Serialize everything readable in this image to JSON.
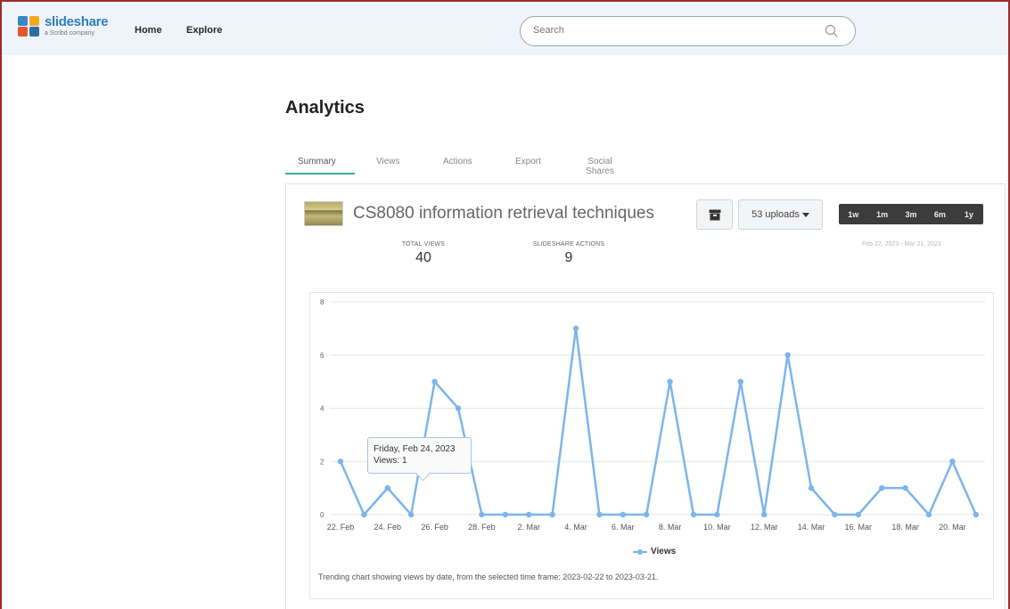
{
  "header": {
    "logo_name": "slideshare",
    "logo_sub": "a Scribd company",
    "nav": [
      "Home",
      "Explore"
    ],
    "search_placeholder": "Search"
  },
  "page_title": "Analytics",
  "tabs": [
    {
      "label": "Summary",
      "active": true
    },
    {
      "label": "Views",
      "active": false
    },
    {
      "label": "Actions",
      "active": false
    },
    {
      "label": "Export",
      "active": false
    },
    {
      "label": "Social Shares",
      "active": false
    }
  ],
  "document": {
    "title": "CS8080 information retrieval techniques",
    "uploads_label": "53 uploads",
    "ranges": [
      "1w",
      "1m",
      "3m",
      "6m",
      "1y"
    ],
    "date_range": "Feb 22, 2023 - Mar 21, 2023"
  },
  "stats": {
    "total_views_label": "TOTAL VIEWS",
    "total_views": "40",
    "actions_label": "SLIDESHARE ACTIONS",
    "actions": "9"
  },
  "tooltip": {
    "date": "Friday, Feb 24, 2023",
    "text": "Views: 1"
  },
  "caption": "Trending chart showing views by date, from the selected time frame: 2023-02-22 to 2023-03-21.",
  "colors": {
    "line": "#7cb5ec",
    "accent": "#3fa6a8",
    "brand": "#2e7fb5"
  },
  "chart_data": {
    "type": "line",
    "ylim": [
      0,
      8
    ],
    "yticks": [
      "0",
      "2",
      "4",
      "6",
      "8"
    ],
    "x_tick_labels": [
      "22. Feb",
      "24. Feb",
      "26. Feb",
      "28. Feb",
      "2. Mar",
      "4. Mar",
      "6. Mar",
      "8. Mar",
      "10. Mar",
      "12. Mar",
      "14. Mar",
      "16. Mar",
      "18. Mar",
      "20. Mar"
    ],
    "dates": [
      "2023-02-22",
      "2023-02-23",
      "2023-02-24",
      "2023-02-25",
      "2023-02-26",
      "2023-02-27",
      "2023-02-28",
      "2023-03-01",
      "2023-03-02",
      "2023-03-03",
      "2023-03-04",
      "2023-03-05",
      "2023-03-06",
      "2023-03-07",
      "2023-03-08",
      "2023-03-09",
      "2023-03-10",
      "2023-03-11",
      "2023-03-12",
      "2023-03-13",
      "2023-03-14",
      "2023-03-15",
      "2023-03-16",
      "2023-03-17",
      "2023-03-18",
      "2023-03-19",
      "2023-03-20",
      "2023-03-21"
    ],
    "series": [
      {
        "name": "Views",
        "values": [
          2,
          0,
          1,
          0,
          5,
          4,
          0,
          0,
          0,
          0,
          7,
          0,
          0,
          0,
          5,
          0,
          0,
          5,
          0,
          6,
          1,
          0,
          0,
          1,
          1,
          0,
          2,
          0
        ]
      }
    ],
    "legend": "bottom-center",
    "grid": true
  }
}
